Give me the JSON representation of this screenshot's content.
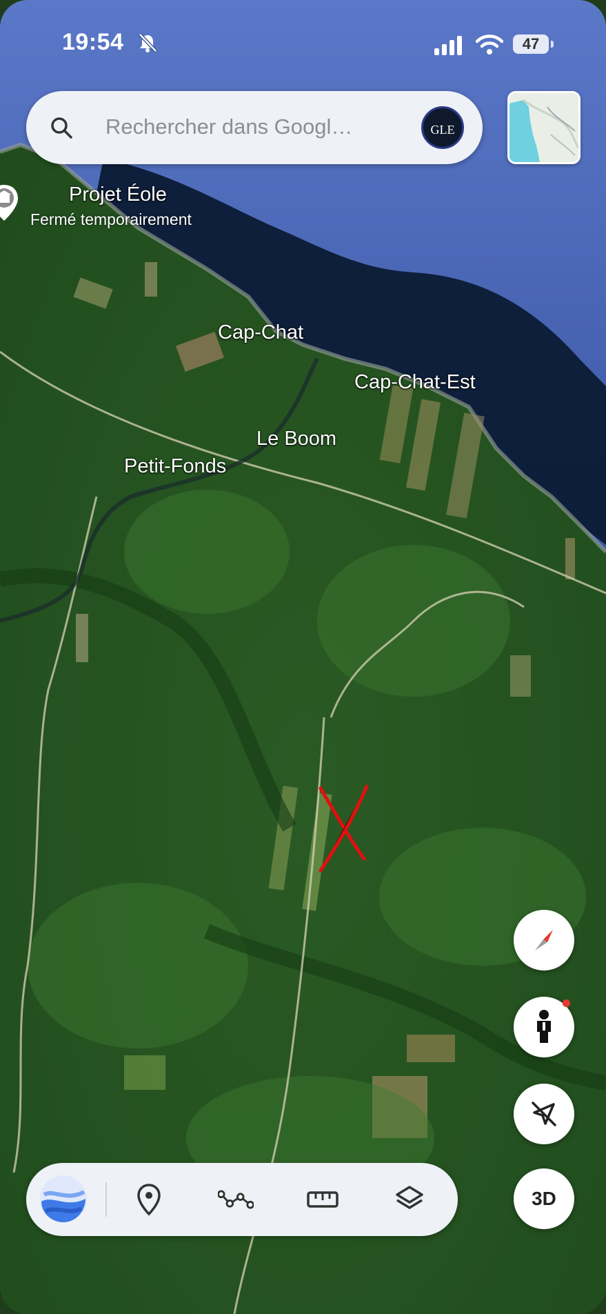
{
  "status_bar": {
    "time": "19:54",
    "battery": "47"
  },
  "search": {
    "placeholder": "Rechercher dans Googl…",
    "avatar_text": "GLE"
  },
  "places": {
    "poi_name": "Projet Éole",
    "poi_status": "Fermé temporairement",
    "town1": "Cap-Chat",
    "town2": "Cap-Chat-Est",
    "town3": "Le Boom",
    "town4": "Petit-Fonds"
  },
  "map_controls": {
    "compass_icon": "compass-icon",
    "street_view_icon": "pegman-icon",
    "location_icon": "location-off-icon",
    "view_3d_label": "3D"
  },
  "toolbar": {
    "items": [
      "earth-logo-icon",
      "pin-icon",
      "path-icon",
      "ruler-icon",
      "layers-icon"
    ]
  },
  "colors": {
    "water_deep": "#0a1e3a",
    "water": "#3a5aa8",
    "land": "#2f5a26",
    "marker": "#e01010"
  }
}
